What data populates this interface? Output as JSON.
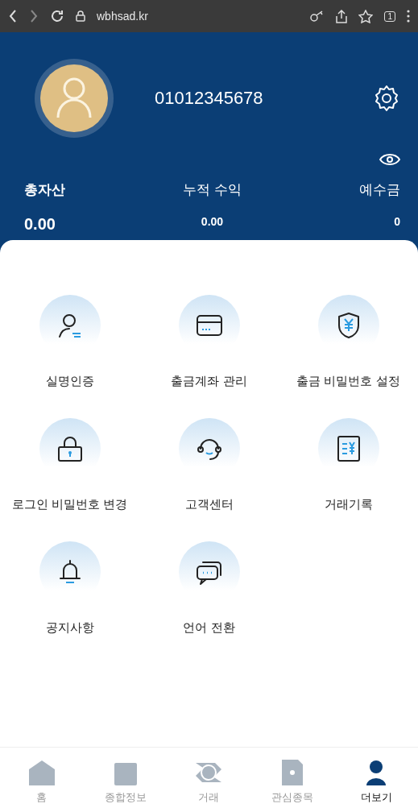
{
  "browser": {
    "url": "wbhsad.kr",
    "tab_count": "1"
  },
  "profile": {
    "phone": "01012345678"
  },
  "summary": [
    {
      "label": "총자산",
      "value": "0.00"
    },
    {
      "label": "누적 수익",
      "value": "0.00"
    },
    {
      "label": "예수금",
      "value": "0"
    }
  ],
  "menu": [
    {
      "label": "실명인증"
    },
    {
      "label": "출금계좌 관리"
    },
    {
      "label": "출금 비밀번호 설정"
    },
    {
      "label": "로그인 비밀번호 변경"
    },
    {
      "label": "고객센터"
    },
    {
      "label": "거래기록"
    },
    {
      "label": "공지사항"
    },
    {
      "label": "언어 전환"
    }
  ],
  "tabs": [
    {
      "label": "홈",
      "selected": false
    },
    {
      "label": "종합정보",
      "selected": false
    },
    {
      "label": "거래",
      "selected": false
    },
    {
      "label": "관심종목",
      "selected": false
    },
    {
      "label": "더보기",
      "selected": true
    }
  ]
}
